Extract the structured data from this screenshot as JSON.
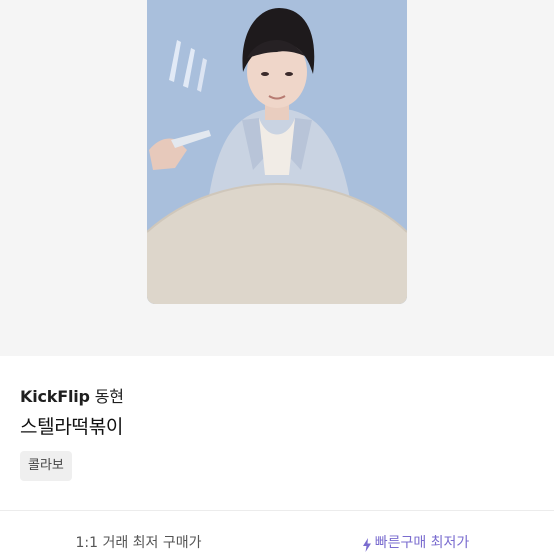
{
  "product": {
    "artist": "KickFlip",
    "member": "동현",
    "name": "스텔라떡볶이",
    "tag": "콜라보"
  },
  "actions": {
    "one_to_one_label": "1:1 거래 최저 구매가",
    "quick_buy_label": "빠른구매 최저가",
    "quick_buy_icon": "lightning-bolt-icon"
  },
  "colors": {
    "hero_background": "#f5f5f5",
    "photo_background": "#a9bfdc",
    "quick_buy_accent": "#7a6ccf"
  }
}
